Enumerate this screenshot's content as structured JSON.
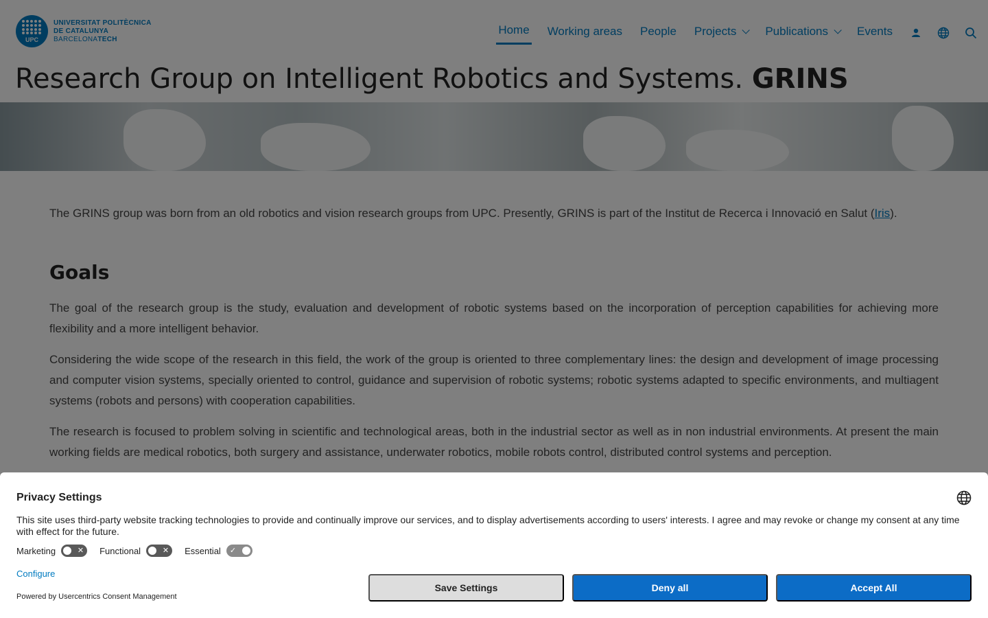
{
  "logo": {
    "upc": "UPC",
    "line1": "UNIVERSITAT POLITÈCNICA",
    "line2": "DE CATALUNYA",
    "line3_light": "BARCELONA",
    "line3_bold": "TECH"
  },
  "nav": {
    "items": [
      {
        "label": "Home",
        "active": true
      },
      {
        "label": "Working areas"
      },
      {
        "label": "People"
      },
      {
        "label": "Projects",
        "dropdown": true
      },
      {
        "label": "Publications",
        "dropdown": true
      },
      {
        "label": "Events"
      }
    ],
    "icons": [
      "user-icon",
      "globe-icon",
      "search-icon"
    ]
  },
  "page": {
    "title_prefix": "Research Group on Intelligent Robotics and Systems.",
    "title_bold": "GRINS"
  },
  "content": {
    "intro_before": "The GRINS group was born from an old robotics and vision research groups from UPC. Presently, GRINS is part of the Institut de Recerca i Innovació en Salut (",
    "intro_link": "Iris",
    "intro_after": ").",
    "goals_heading": "Goals",
    "paragraphs": [
      "The goal of the research group is the study, evaluation and development of robotic systems based on the incorporation of perception capabilities for achieving more flexibility and a more intelligent behavior.",
      "Considering the wide scope of the research in this field, the work of the group is oriented to three complementary lines: the design and development of image processing and computer vision systems, specially oriented to control, guidance and supervision of robotic systems; robotic systems adapted to specific environments, and multiagent systems (robots and persons) with cooperation capabilities.",
      "The research is focused to problem solving in scientific and technological areas, both in the industrial sector as well as in non industrial environments. At present the main working fields are medical robotics, both surgery and assistance, underwater robotics, mobile robots control, distributed control systems and perception."
    ]
  },
  "privacy": {
    "title": "Privacy Settings",
    "description": "This site uses third-party website tracking technologies to provide and continually improve our services, and to display advertisements according to users' interests. I agree and may revoke or change my consent at any time with effect for the future.",
    "toggles": [
      {
        "label": "Marketing",
        "state": "off"
      },
      {
        "label": "Functional",
        "state": "off"
      },
      {
        "label": "Essential",
        "state": "on"
      }
    ],
    "configure": "Configure",
    "powered": "Powered by Usercentrics Consent Management",
    "buttons": {
      "save": "Save Settings",
      "deny": "Deny all",
      "accept": "Accept All"
    }
  },
  "colors": {
    "brand": "#007bc0",
    "button_primary": "#0c6cc6",
    "button_secondary": "#dddddd"
  }
}
